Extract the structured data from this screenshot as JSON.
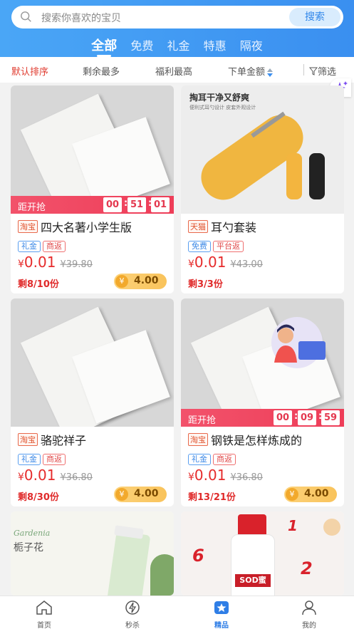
{
  "search": {
    "placeholder": "搜索你喜欢的宝贝",
    "button": "搜索"
  },
  "tabs": [
    "全部",
    "免费",
    "礼金",
    "特惠",
    "隔夜"
  ],
  "sort": {
    "default": "默认排序",
    "most_left": "剩余最多",
    "best_benefit": "福利最高",
    "order_amount": "下单金额",
    "filter": "筛选"
  },
  "cards": [
    {
      "countdown_label": "距开抢",
      "countdown": [
        "00",
        "51",
        "01"
      ],
      "platform": "淘宝",
      "title": "四大名著小学生版",
      "tags": [
        "礼金",
        "商返"
      ],
      "yen": "¥",
      "price": "0.01",
      "orig": "¥39.80",
      "remain": "剩8/10份",
      "coin": "4.00"
    },
    {
      "image_heading": "掏耳干净又舒爽",
      "image_sub": "便利式耳勺设计  皮套外观设计",
      "platform": "天猫",
      "title": "耳勺套装",
      "tags": [
        "免费",
        "平台返"
      ],
      "yen": "¥",
      "price": "0.01",
      "orig": "¥43.00",
      "remain": "剩3/3份",
      "coin": ""
    },
    {
      "platform": "淘宝",
      "title": "骆驼祥子",
      "tags": [
        "礼金",
        "商返"
      ],
      "yen": "¥",
      "price": "0.01",
      "orig": "¥36.80",
      "remain": "剩8/30份",
      "coin": "4.00"
    },
    {
      "countdown_label": "距开抢",
      "countdown": [
        "00",
        "09",
        "59"
      ],
      "platform": "淘宝",
      "title": "钢铁是怎样炼成的",
      "tags": [
        "礼金",
        "商返"
      ],
      "yen": "¥",
      "price": "0.01",
      "orig": "¥36.80",
      "remain": "剩13/21份",
      "coin": "4.00"
    },
    {
      "image_heading": "栀子花",
      "image_script": "Gardenia"
    },
    {
      "image_brand": "SOD蜜"
    }
  ],
  "tabbar": [
    "首页",
    "秒杀",
    "精品",
    "我的"
  ],
  "colors": {
    "brand_blue": "#3a8ff0",
    "price_red": "#e62b2b",
    "countdown_red": "#ee3d58"
  }
}
